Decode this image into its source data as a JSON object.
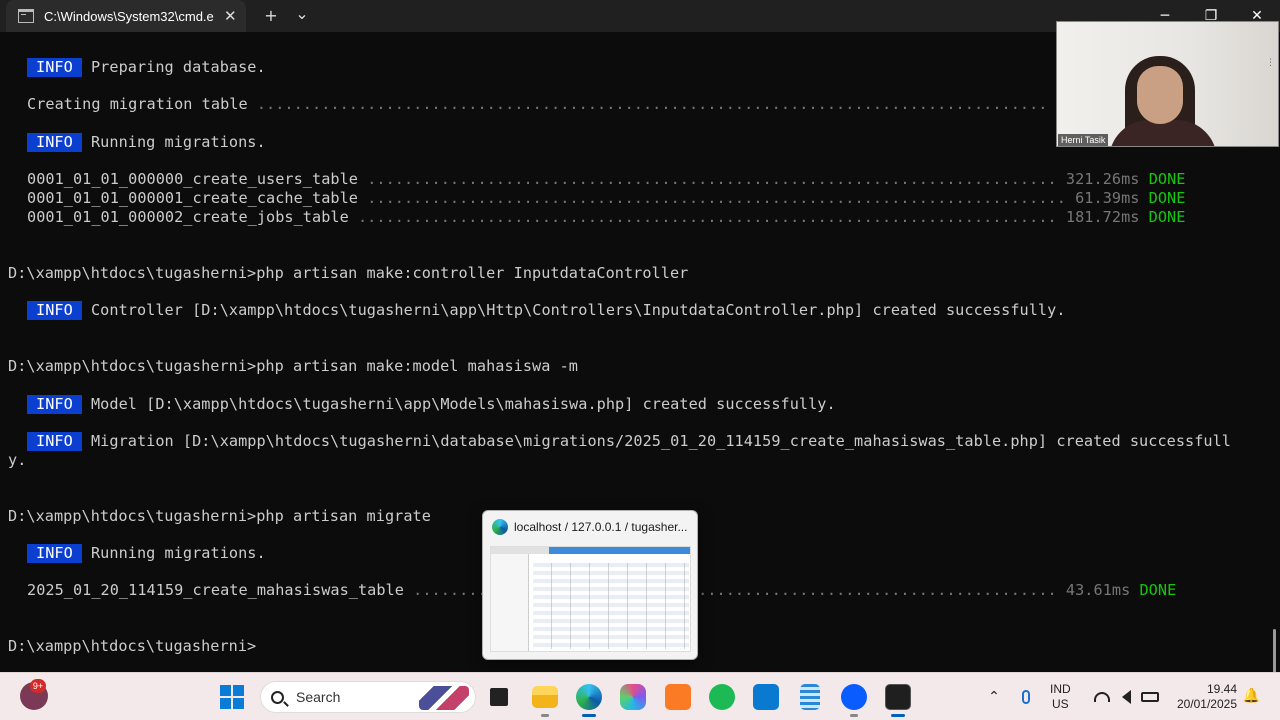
{
  "window": {
    "tab_title": "C:\\Windows\\System32\\cmd.e",
    "tab_close": "✕",
    "new_tab": "+",
    "dropdown": "⌄",
    "minimize": "─",
    "restore": "❐",
    "close": "✕"
  },
  "terminal": {
    "info_label": "INFO",
    "lines": [
      {
        "type": "info",
        "text": "Preparing database."
      },
      {
        "type": "text",
        "text": "Creating migration table ",
        "dots": "......................................................................................"
      },
      {
        "type": "info",
        "text": "Running migrations."
      },
      {
        "type": "migration",
        "name": "0001_01_01_000000_create_users_table",
        "dots": "...........................................................................",
        "time": "321.26ms",
        "status": "DONE"
      },
      {
        "type": "migration",
        "name": "0001_01_01_000001_create_cache_table",
        "dots": "............................................................................",
        "time": "61.39ms",
        "status": "DONE"
      },
      {
        "type": "migration",
        "name": "0001_01_01_000002_create_jobs_table",
        "dots": "............................................................................",
        "time": "181.72ms",
        "status": "DONE"
      },
      {
        "type": "prompt",
        "text": "D:\\xampp\\htdocs\\tugasherni>php artisan make:controller InputdataController"
      },
      {
        "type": "info",
        "text": "Controller [D:\\xampp\\htdocs\\tugasherni\\app\\Http\\Controllers\\InputdataController.php] created successfully."
      },
      {
        "type": "prompt",
        "text": "D:\\xampp\\htdocs\\tugasherni>php artisan make:model mahasiswa -m"
      },
      {
        "type": "info",
        "text": "Model [D:\\xampp\\htdocs\\tugasherni\\app\\Models\\mahasiswa.php] created successfully."
      },
      {
        "type": "info",
        "text": "Migration [D:\\xampp\\htdocs\\tugasherni\\database\\migrations/2025_01_20_114159_create_mahasiswas_table.php] created successfull"
      },
      {
        "type": "wrap",
        "text": "y."
      },
      {
        "type": "prompt",
        "text": "D:\\xampp\\htdocs\\tugasherni>php artisan migrate"
      },
      {
        "type": "info",
        "text": "Running migrations."
      },
      {
        "type": "migration",
        "name": "2025_01_20_114159_create_mahasiswas_table",
        "dots": "......................................................................",
        "time": "43.61ms",
        "status": "DONE"
      },
      {
        "type": "prompt",
        "text": "D:\\xampp\\htdocs\\tugasherni>"
      }
    ]
  },
  "video": {
    "name": "Herni Tasik",
    "more": "⋮"
  },
  "preview": {
    "title": "localhost / 127.0.0.1 / tugasher..."
  },
  "taskbar": {
    "widget_badge": "9+",
    "search_placeholder": "Search",
    "lang_top": "IND",
    "lang_bottom": "US",
    "time": "19.44",
    "date": "20/01/2025",
    "colors": {
      "accent": "#005fb8",
      "done": "#16c60c",
      "info_badge": "#0b3fd0"
    }
  }
}
